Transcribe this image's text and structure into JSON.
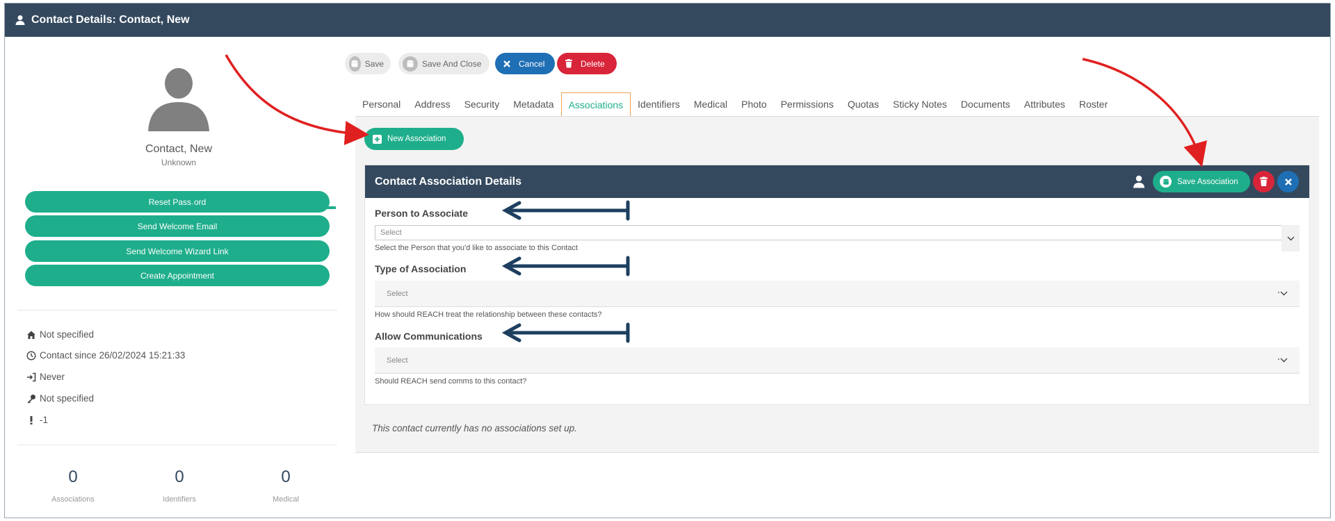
{
  "window": {
    "title": "Contact Details: Contact, New",
    "title_icon": "user-icon"
  },
  "profile": {
    "name": "Contact, New",
    "subtitle": "Unknown",
    "avatar_icon": "user-silhouette-icon"
  },
  "actions": {
    "reset_password": "Reset Pass˒ord",
    "send_welcome_email": "Send Welcome Email",
    "send_welcome_wizard": "Send Welcome Wizard Link",
    "create_appointment": "Create Appointment"
  },
  "info": {
    "home": "Not specified",
    "contact_since": "Contact since 26/02/2024 15:21:33",
    "last_login": "Never",
    "key": "Not specified",
    "alert": "-1"
  },
  "stats": [
    {
      "value": "0",
      "label": "Associations"
    },
    {
      "value": "0",
      "label": "Identifiers"
    },
    {
      "value": "0",
      "label": "Medical"
    }
  ],
  "toolbar": {
    "save": "Save",
    "save_and_close": "Save And Close",
    "cancel": "Cancel",
    "delete": "Delete"
  },
  "tabs": [
    "Personal",
    "Address",
    "Security",
    "Metadata",
    "Associations",
    "Identifiers",
    "Medical",
    "Photo",
    "Permissions",
    "Quotas",
    "Sticky Notes",
    "Documents",
    "Attributes",
    "Roster"
  ],
  "active_tab": "Associations",
  "new_association": "New Association",
  "card": {
    "title": "Contact Association Details",
    "save_association": "Save Association",
    "fields": {
      "person": {
        "label": "Person to Associate",
        "value": "Select",
        "help": "Select the Person that you'd like to associate to this Contact"
      },
      "type": {
        "label": "Type of Association",
        "value": "Select",
        "help": "How should REACH treat the relationship between these contacts?"
      },
      "comms": {
        "label": "Allow Communications",
        "value": "Select",
        "help": "Should REACH send comms to this contact?"
      }
    }
  },
  "empty_message": "This contact currently has no associations set up.",
  "colors": {
    "header": "#34495e",
    "accent_green": "#1fae8c",
    "cancel_blue": "#1f6fb5",
    "delete_red": "#d9253a",
    "annotation_red": "#e02020",
    "annotation_navy": "#1e3f5f"
  }
}
